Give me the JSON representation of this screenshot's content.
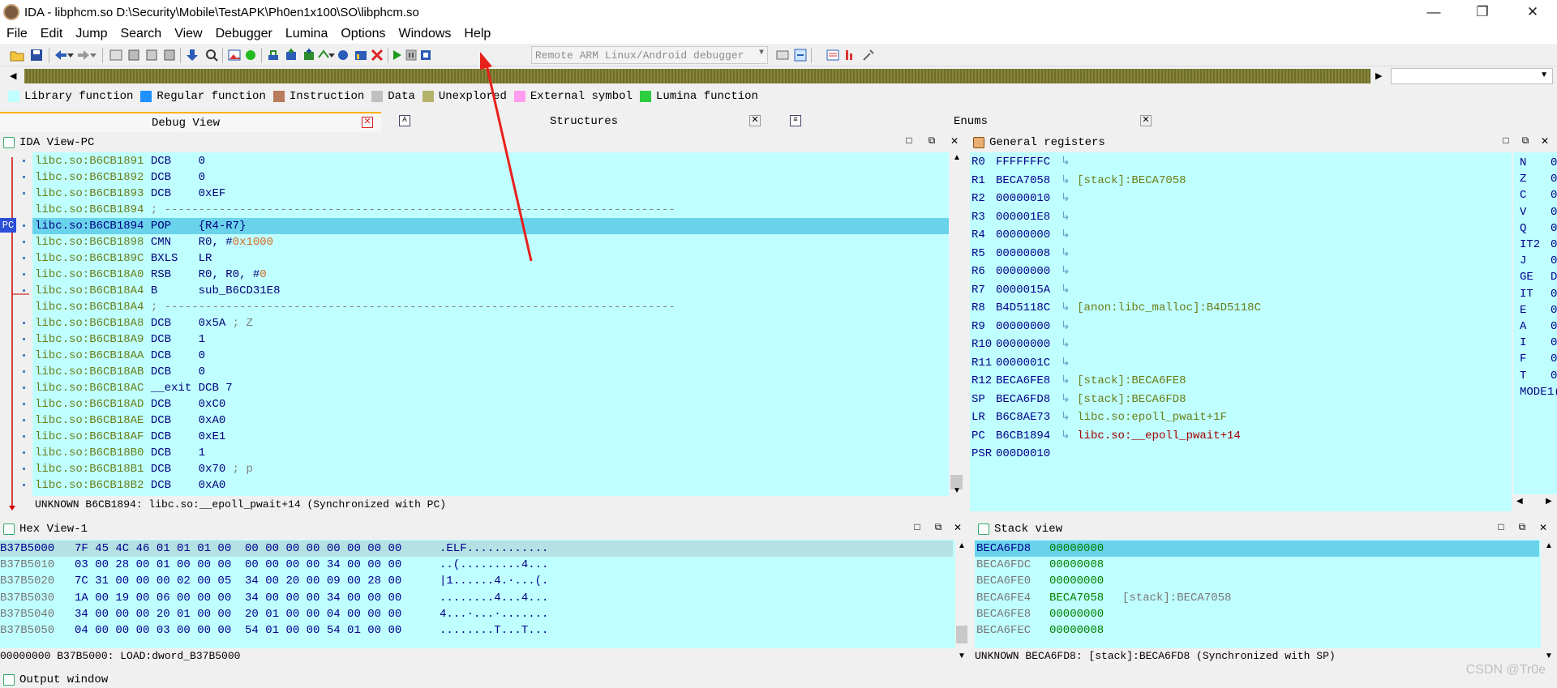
{
  "window": {
    "title": "IDA - libphcm.so D:\\Security\\Mobile\\TestAPK\\Ph0en1x100\\SO\\libphcm.so",
    "controls": [
      "—",
      "❐",
      "✕"
    ]
  },
  "menu": [
    "File",
    "Edit",
    "Jump",
    "Search",
    "View",
    "Debugger",
    "Lumina",
    "Options",
    "Windows",
    "Help"
  ],
  "toolbar": {
    "debugger": "Remote ARM Linux/Android debugger"
  },
  "legend": [
    {
      "label": "Library function",
      "color": "#c0ffff"
    },
    {
      "label": "Regular function",
      "color": "#1e90ff"
    },
    {
      "label": "Instruction",
      "color": "#b87b5c"
    },
    {
      "label": "Data",
      "color": "#c0c0c0"
    },
    {
      "label": "Unexplored",
      "color": "#b5b36b"
    },
    {
      "label": "External symbol",
      "color": "#ff9ef0"
    },
    {
      "label": "Lumina function",
      "color": "#2ecc40"
    }
  ],
  "tabs": [
    {
      "label": "Debug View"
    },
    {
      "label": "Structures"
    },
    {
      "label": "Enums"
    }
  ],
  "ida_view": {
    "title": "IDA View-PC",
    "pc_label": "PC",
    "lines": [
      {
        "addr": "libc.so:B6CB1891",
        "op": "DCB",
        "arg": "0"
      },
      {
        "addr": "libc.so:B6CB1892",
        "op": "DCB",
        "arg": "0"
      },
      {
        "addr": "libc.so:B6CB1893",
        "op": "DCB",
        "arg": "0xEF"
      },
      {
        "addr": "libc.so:B6CB1894",
        "op": "; ---------------------------------------------------------------------------",
        "arg": ""
      },
      {
        "addr": "libc.so:B6CB1894",
        "op": "POP",
        "arg": "{R4-R7}"
      },
      {
        "addr": "libc.so:B6CB1898",
        "op": "CMN",
        "arg": "R0, #",
        "arg2": "0x1000"
      },
      {
        "addr": "libc.so:B6CB189C",
        "op": "BXLS",
        "arg": "LR"
      },
      {
        "addr": "libc.so:B6CB18A0",
        "op": "RSB",
        "arg": "R0, R0, #",
        "arg2": "0"
      },
      {
        "addr": "libc.so:B6CB18A4",
        "op": "B",
        "arg": "sub_B6CD31E8"
      },
      {
        "addr": "libc.so:B6CB18A4",
        "op": "; ---------------------------------------------------------------------------",
        "arg": ""
      },
      {
        "addr": "libc.so:B6CB18A8",
        "op": "DCB",
        "arg": "0x5A",
        "cmt": "; Z"
      },
      {
        "addr": "libc.so:B6CB18A9",
        "op": "DCB",
        "arg": "1"
      },
      {
        "addr": "libc.so:B6CB18AA",
        "op": "DCB",
        "arg": "0"
      },
      {
        "addr": "libc.so:B6CB18AB",
        "op": "DCB",
        "arg": "0"
      },
      {
        "addr": "libc.so:B6CB18AC",
        "op": "__exit DCB",
        "arg": "7"
      },
      {
        "addr": "libc.so:B6CB18AD",
        "op": "DCB",
        "arg": "0xC0"
      },
      {
        "addr": "libc.so:B6CB18AE",
        "op": "DCB",
        "arg": "0xA0"
      },
      {
        "addr": "libc.so:B6CB18AF",
        "op": "DCB",
        "arg": "0xE1"
      },
      {
        "addr": "libc.so:B6CB18B0",
        "op": "DCB",
        "arg": "1"
      },
      {
        "addr": "libc.so:B6CB18B1",
        "op": "DCB",
        "arg": "0x70",
        "cmt": "; p"
      },
      {
        "addr": "libc.so:B6CB18B2",
        "op": "DCB",
        "arg": "0xA0"
      }
    ],
    "status": "UNKNOWN B6CB1894: libc.so:__epoll_pwait+14 (Synchronized with PC)"
  },
  "registers": {
    "title": "General registers",
    "rows": [
      {
        "name": "R0",
        "value": "FFFFFFFC",
        "ref": ""
      },
      {
        "name": "R1",
        "value": "BECA7058",
        "ref": "[stack]:BECA7058"
      },
      {
        "name": "R2",
        "value": "00000010",
        "ref": ""
      },
      {
        "name": "R3",
        "value": "000001E8",
        "ref": ""
      },
      {
        "name": "R4",
        "value": "00000000",
        "ref": ""
      },
      {
        "name": "R5",
        "value": "00000008",
        "ref": ""
      },
      {
        "name": "R6",
        "value": "00000000",
        "ref": ""
      },
      {
        "name": "R7",
        "value": "0000015A",
        "ref": ""
      },
      {
        "name": "R8",
        "value": "B4D5118C",
        "ref": "[anon:libc_malloc]:B4D5118C"
      },
      {
        "name": "R9",
        "value": "00000000",
        "ref": ""
      },
      {
        "name": "R10",
        "value": "00000000",
        "ref": ""
      },
      {
        "name": "R11",
        "value": "0000001C",
        "ref": ""
      },
      {
        "name": "R12",
        "value": "BECA6FE8",
        "ref": "[stack]:BECA6FE8"
      },
      {
        "name": "SP",
        "value": "BECA6FD8",
        "ref": "[stack]:BECA6FD8"
      },
      {
        "name": "LR",
        "value": "B6C8AE73",
        "ref": "libc.so:epoll_pwait+1F"
      },
      {
        "name": "PC",
        "value": "B6CB1894",
        "ref": "libc.so:__epoll_pwait+14"
      },
      {
        "name": "PSR",
        "value": "000D0010",
        "ref": ""
      }
    ],
    "flags": [
      {
        "name": "N",
        "value": "0"
      },
      {
        "name": "Z",
        "value": "0"
      },
      {
        "name": "C",
        "value": "0"
      },
      {
        "name": "V",
        "value": "0"
      },
      {
        "name": "Q",
        "value": "0"
      },
      {
        "name": "IT2",
        "value": "0"
      },
      {
        "name": "J",
        "value": "0"
      },
      {
        "name": "GE",
        "value": "D"
      },
      {
        "name": "IT",
        "value": "0"
      },
      {
        "name": "E",
        "value": "0"
      },
      {
        "name": "A",
        "value": "0"
      },
      {
        "name": "I",
        "value": "0"
      },
      {
        "name": "F",
        "value": "0"
      },
      {
        "name": "T",
        "value": "0"
      },
      {
        "name": "MODE",
        "value": "1("
      }
    ]
  },
  "hex_view": {
    "title": "Hex View-1",
    "rows": [
      {
        "addr": "B37B5000",
        "bytes": "7F 45 4C 46 01 01 01 00  00 00 00 00 00 00 00 00",
        "ascii": ".ELF............"
      },
      {
        "addr": "B37B5010",
        "bytes": "03 00 28 00 01 00 00 00  00 00 00 00 34 00 00 00",
        "ascii": "..(.........4..."
      },
      {
        "addr": "B37B5020",
        "bytes": "7C 31 00 00 00 02 00 05  34 00 20 00 09 00 28 00",
        "ascii": "|1......4.·...(."
      },
      {
        "addr": "B37B5030",
        "bytes": "1A 00 19 00 06 00 00 00  34 00 00 00 34 00 00 00",
        "ascii": "........4...4..."
      },
      {
        "addr": "B37B5040",
        "bytes": "34 00 00 00 20 01 00 00  20 01 00 00 04 00 00 00",
        "ascii": "4...·...·......."
      },
      {
        "addr": "B37B5050",
        "bytes": "04 00 00 00 03 00 00 00  54 01 00 00 54 01 00 00",
        "ascii": "........T...T..."
      }
    ],
    "status": "00000000 B37B5000: LOAD:dword_B37B5000"
  },
  "stack_view": {
    "title": "Stack view",
    "rows": [
      {
        "addr": "BECA6FD8",
        "value": "00000000",
        "ref": ""
      },
      {
        "addr": "BECA6FDC",
        "value": "00000008",
        "ref": ""
      },
      {
        "addr": "BECA6FE0",
        "value": "00000000",
        "ref": ""
      },
      {
        "addr": "BECA6FE4",
        "value": "BECA7058",
        "ref": "[stack]:BECA7058"
      },
      {
        "addr": "BECA6FE8",
        "value": "00000000",
        "ref": ""
      },
      {
        "addr": "BECA6FEC",
        "value": "00000008",
        "ref": ""
      }
    ],
    "status": "UNKNOWN BECA6FD8: [stack]:BECA6FD8 (Synchronized with SP)"
  },
  "output": {
    "title": "Output window"
  },
  "watermark": "CSDN @Tr0e"
}
